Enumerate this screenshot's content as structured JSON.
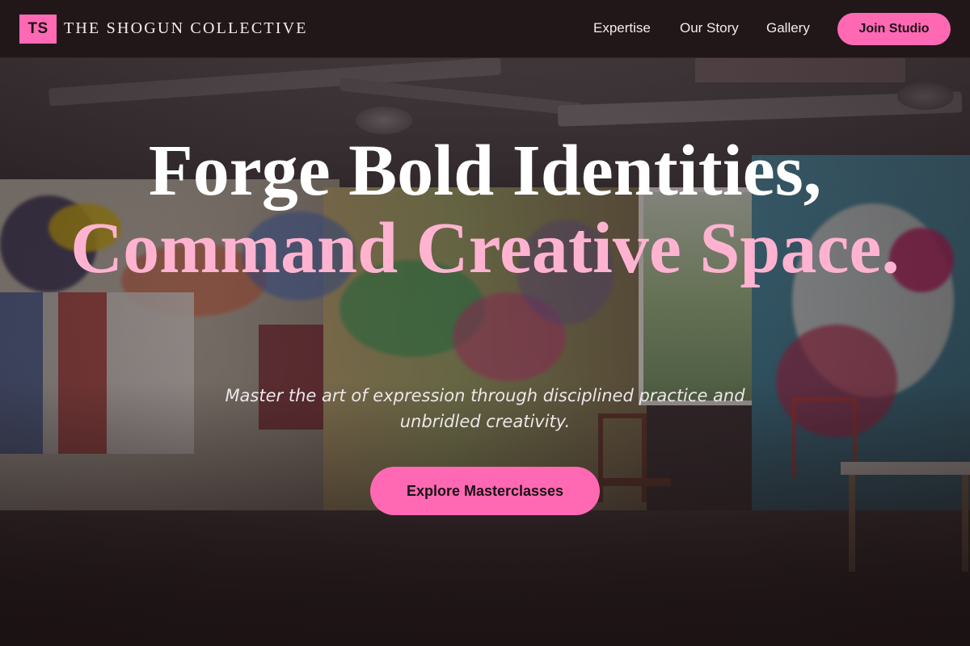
{
  "header": {
    "logo_initials": "TS",
    "brand_name": "THE SHOGUN COLLECTIVE",
    "nav": {
      "expertise": "Expertise",
      "our_story": "Our Story",
      "gallery": "Gallery"
    },
    "join_label": "Join Studio"
  },
  "hero": {
    "headline_line1": "Forge Bold Identities,",
    "headline_line2": "Command Creative Space.",
    "subtitle": "Master the art of expression through disciplined practice and unbridled creativity.",
    "cta_label": "Explore Masterclasses",
    "background_image": "graffiti art studio interior"
  },
  "colors": {
    "accent_pink": "#ff69b4",
    "headline_pink": "#ffb3d1",
    "header_bg": "#211719"
  }
}
